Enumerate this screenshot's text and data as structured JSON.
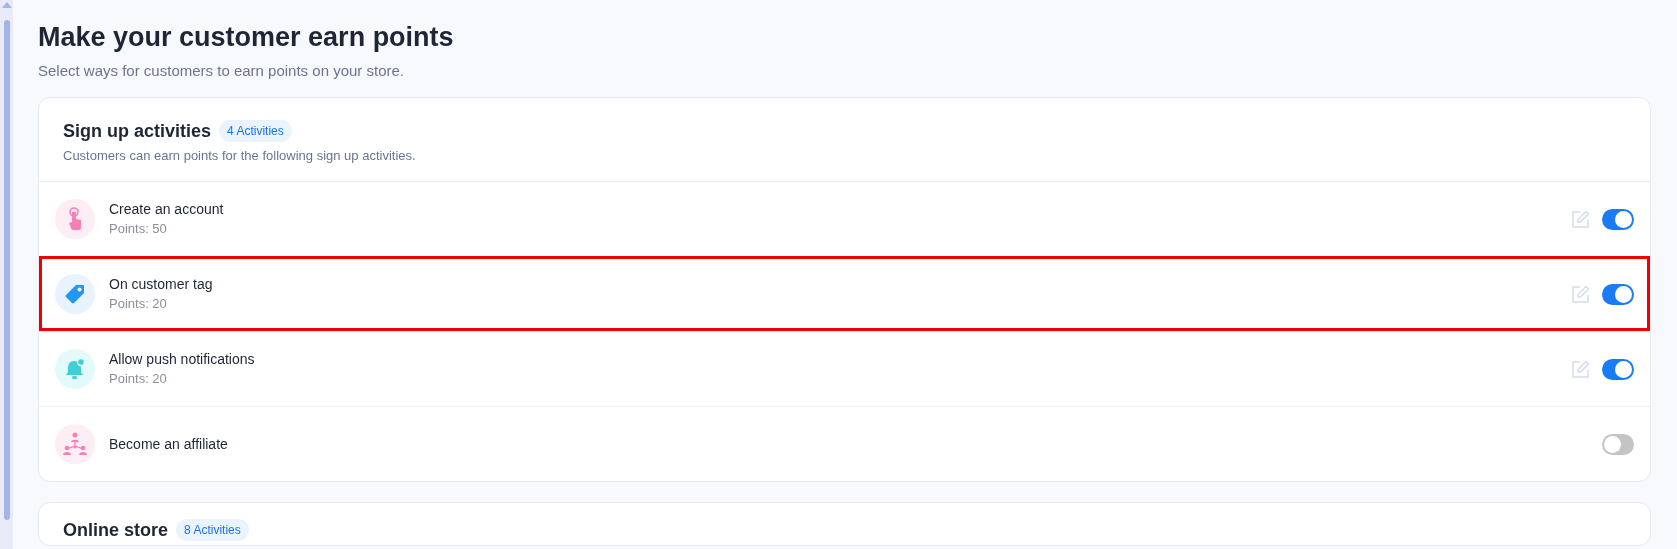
{
  "page": {
    "title": "Make your customer earn points",
    "subtitle": "Select ways for customers to earn points on your store."
  },
  "sections": [
    {
      "title": "Sign up activities",
      "badge": "4 Activities",
      "description": "Customers can earn points for the following sign up activities.",
      "activities": [
        {
          "kind": "account",
          "name": "Create an account",
          "points": "Points: 50",
          "editable": true,
          "on": true,
          "highlighted": false
        },
        {
          "kind": "tag",
          "name": "On customer tag",
          "points": "Points: 20",
          "editable": true,
          "on": true,
          "highlighted": true
        },
        {
          "kind": "notification",
          "name": "Allow push notifications",
          "points": "Points: 20",
          "editable": true,
          "on": true,
          "highlighted": false
        },
        {
          "kind": "affiliate",
          "name": "Become an affiliate",
          "editable": false,
          "on": false,
          "highlighted": false
        }
      ]
    },
    {
      "title": "Online store",
      "badge": "8 Activities"
    }
  ]
}
